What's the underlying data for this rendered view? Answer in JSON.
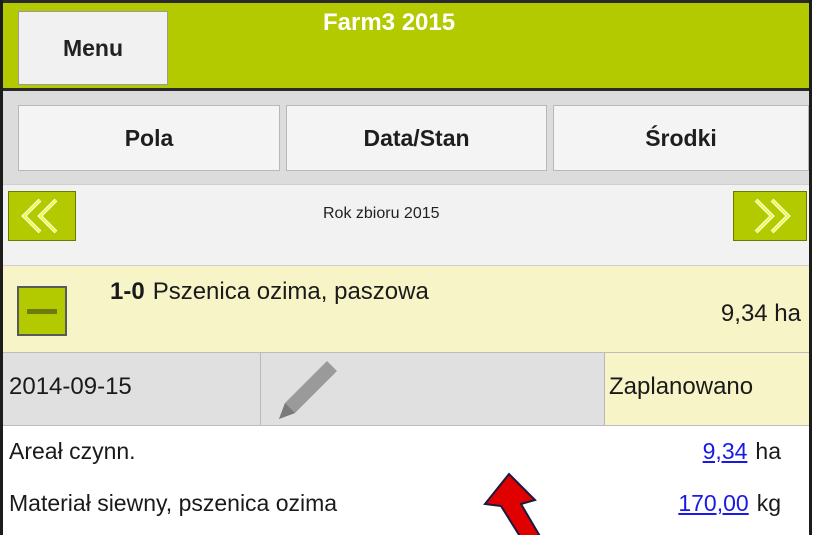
{
  "header": {
    "menu_label": "Menu",
    "title": "Farm3 2015",
    "accent_color": "#b3c900"
  },
  "tabs": [
    {
      "label": "Pola"
    },
    {
      "label": "Data/Stan"
    },
    {
      "label": "Środki"
    }
  ],
  "year_nav": {
    "label": "Rok zbioru 2015",
    "prev_icon": "double-chevron-left-icon",
    "next_icon": "double-chevron-right-icon"
  },
  "crop": {
    "code": "1-0",
    "name": "Pszenica ozima, paszowa",
    "area": "9,34 ha",
    "collapse_icon": "minus-icon"
  },
  "operation": {
    "date": "2014-09-15",
    "edit_icon": "pencil-icon",
    "status": "Zaplanowano"
  },
  "details": [
    {
      "label": "Areał czynn.",
      "value": "9,34",
      "unit": "ha"
    },
    {
      "label": "Materiał siewny, pszenica ozima",
      "value": "170,00",
      "unit": "kg"
    }
  ],
  "annotation": {
    "icon": "red-arrow-pointer-icon",
    "color": "#e00000"
  }
}
